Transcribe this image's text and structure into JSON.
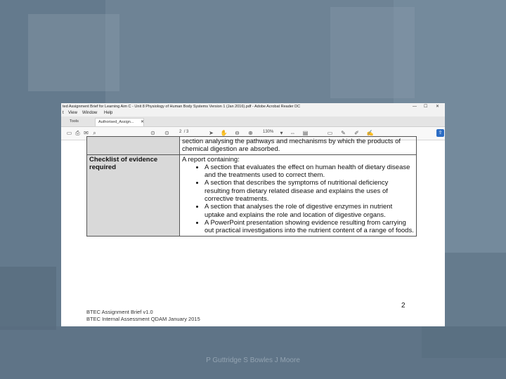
{
  "window": {
    "title": "ted Assignment Brief for Learning Aim C - Unit 8 Physiology of Human Body Systems Version 1 (Jan 2016).pdf - Adobe Acrobat Reader DC",
    "menu": [
      "t",
      "View",
      "Window",
      "Help"
    ],
    "tabs": [
      "Tools",
      "Authorised_Assign..."
    ],
    "page_current": "2",
    "page_total": "/ 3",
    "zoom": "130%"
  },
  "document": {
    "top_row_text": "section analysing the pathways and mechanisms by which the products of chemical digestion are absorbed.",
    "checklist_heading": "Checklist of evidence required",
    "report_intro": "A report containing:",
    "bullets": [
      "A section that evaluates the effect on human health of dietary disease and the treatments used to correct them.",
      "A section that describes the symptoms of nutritional deficiency resulting from dietary related disease and explains the uses of corrective treatments.",
      "A section that analyses the role of digestive enzymes in nutrient uptake and explains the role and location of digestive organs.",
      "A PowerPoint presentation showing evidence resulting from carrying out practical investigations into the nutrient content of a range of foods."
    ],
    "page_number": "2",
    "footer_line1": "BTEC Assignment Brief v1.0",
    "footer_line2": "BTEC Internal Assessment QDAM January 2015"
  },
  "slide": {
    "caption": "P Guttridge S Bowles J Moore"
  }
}
